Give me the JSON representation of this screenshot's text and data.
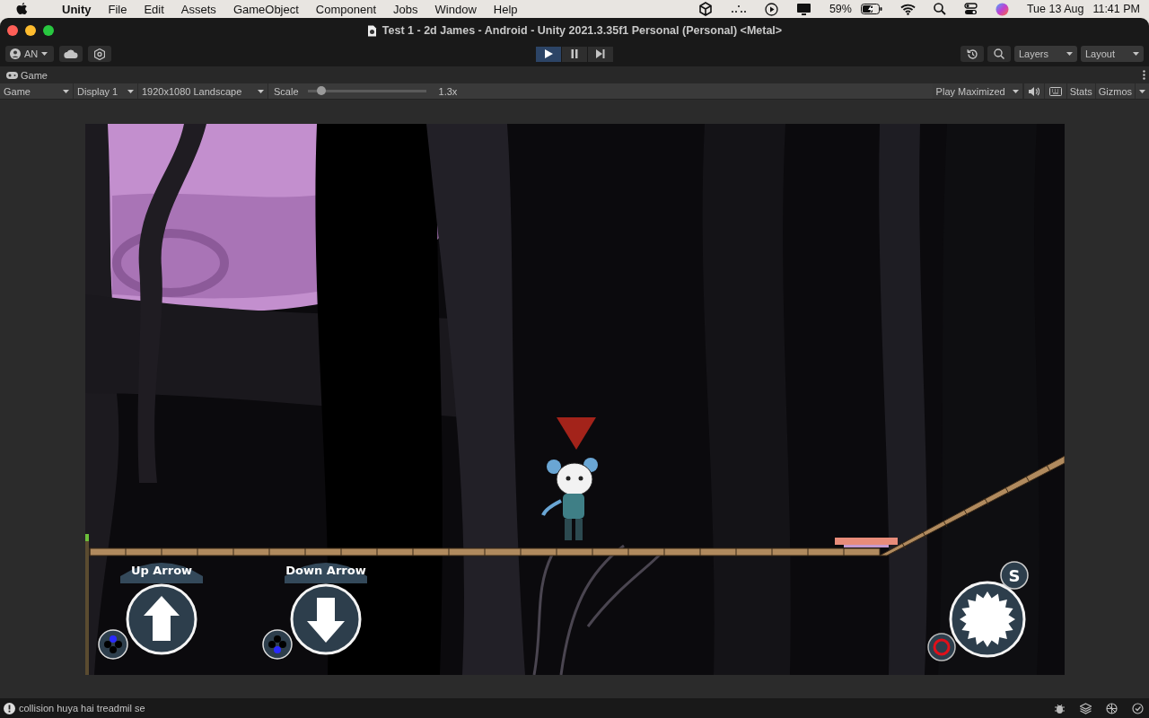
{
  "menu_bar": {
    "app": "Unity",
    "items": [
      "File",
      "Edit",
      "Assets",
      "GameObject",
      "Component",
      "Jobs",
      "Window",
      "Help"
    ],
    "battery": "59%",
    "date": "Tue 13 Aug",
    "time": "11:41 PM"
  },
  "window": {
    "title": "Test 1 - 2d James - Android - Unity 2021.3.35f1 Personal (Personal) <Metal>"
  },
  "toolbar": {
    "account": "AN",
    "play_controls": [
      {
        "kind": "play",
        "selected": true
      },
      {
        "kind": "pause",
        "selected": false
      },
      {
        "kind": "step",
        "selected": false
      }
    ],
    "layers": "Layers",
    "layout": "Layout"
  },
  "tab": {
    "label": "Game"
  },
  "game_toolbar": {
    "view": "Game",
    "display": "Display 1",
    "resolution": "1920x1080 Landscape",
    "scale_label": "Scale",
    "scale": {
      "level": 0.12
    },
    "scale_reading": "1.3x",
    "play_mode": "Play Maximized",
    "stats": "Stats",
    "gizmos": "Gizmos"
  },
  "game": {
    "buttons": [
      {
        "kind": "up",
        "label": "Up Arrow"
      },
      {
        "kind": "down",
        "label": "Down Arrow"
      },
      {
        "kind": "saw",
        "label": "S"
      }
    ]
  },
  "status_bar": {
    "message": "collision huya hai treadmil se"
  }
}
